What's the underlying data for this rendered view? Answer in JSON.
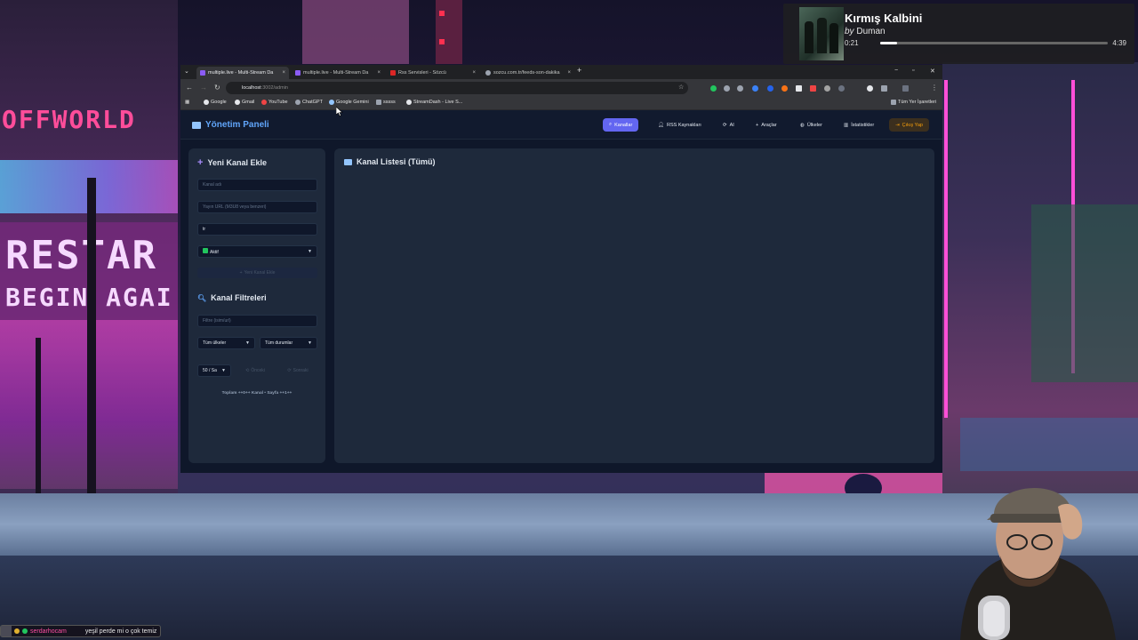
{
  "now_playing": {
    "title": "Kırmış Kalbini",
    "by": "by",
    "artist": "Duman",
    "elapsed": "0:21",
    "duration": "4:39",
    "progress": 0.075
  },
  "chat": {
    "username": "serdarhocam",
    "message": "yeşil perde mi o çok temiz"
  },
  "scene_text": {
    "sign1": "OFFWORLD",
    "sign2": "RESTAR",
    "sign3": "BEGIN AGAI"
  },
  "browser": {
    "tabs": [
      {
        "label": "multiple.live - Multi-Stream Da",
        "active": true
      },
      {
        "label": "multiple.live - Multi-Stream Da",
        "active": false
      },
      {
        "label": "Rss Servisleri - Sözcü",
        "active": false
      },
      {
        "label": "sozcu.com.tr/feeds-son-dakika",
        "active": false
      }
    ],
    "new_tab": "+",
    "url_host": "localhost",
    "url_path": ":3002/admin",
    "bookmarks": [
      "Google",
      "Gmail",
      "YouTube",
      "ChatGPT",
      "Google Gemini",
      "sssss",
      "StreamDash - Live S..."
    ],
    "all_bookmarks": "Tüm Yer İşaretleri"
  },
  "app": {
    "brand": "Yönetim Paneli",
    "nav": [
      {
        "label": "Kanallar",
        "icon": "search-icon",
        "active": true
      },
      {
        "label": "RSS Kaynakları",
        "icon": "user-icon"
      },
      {
        "label": "AI",
        "icon": "refresh-icon"
      },
      {
        "label": "Araçlar",
        "icon": "plus-icon"
      },
      {
        "label": "Ülkeler",
        "icon": "globe-icon"
      },
      {
        "label": "İstatistikler",
        "icon": "chart-icon"
      },
      {
        "label": "Çıkış Yap",
        "icon": "logout-icon"
      }
    ],
    "add_channel": {
      "title": "Yeni Kanal Ekle",
      "name_placeholder": "Kanal adı",
      "url_placeholder": "Yayın URL (M3U8 veya benzeri)",
      "country_value": "tr",
      "status_value": "Aktif",
      "submit_label": "Yeni Kanal Ekle"
    },
    "filters": {
      "title": "Kanal Filtreleri",
      "search_placeholder": "Filtre (isim/url)",
      "country_select": "Tüm ülkeler",
      "status_select": "Tüm durumlar",
      "page_size": "50 / Sa",
      "prev_label": "Önceki",
      "next_label": "Sonraki",
      "summary": "Toplam ++0++ Kanal • Sayfa ++1++"
    },
    "list": {
      "title": "Kanal Listesi (Tümü)"
    }
  }
}
